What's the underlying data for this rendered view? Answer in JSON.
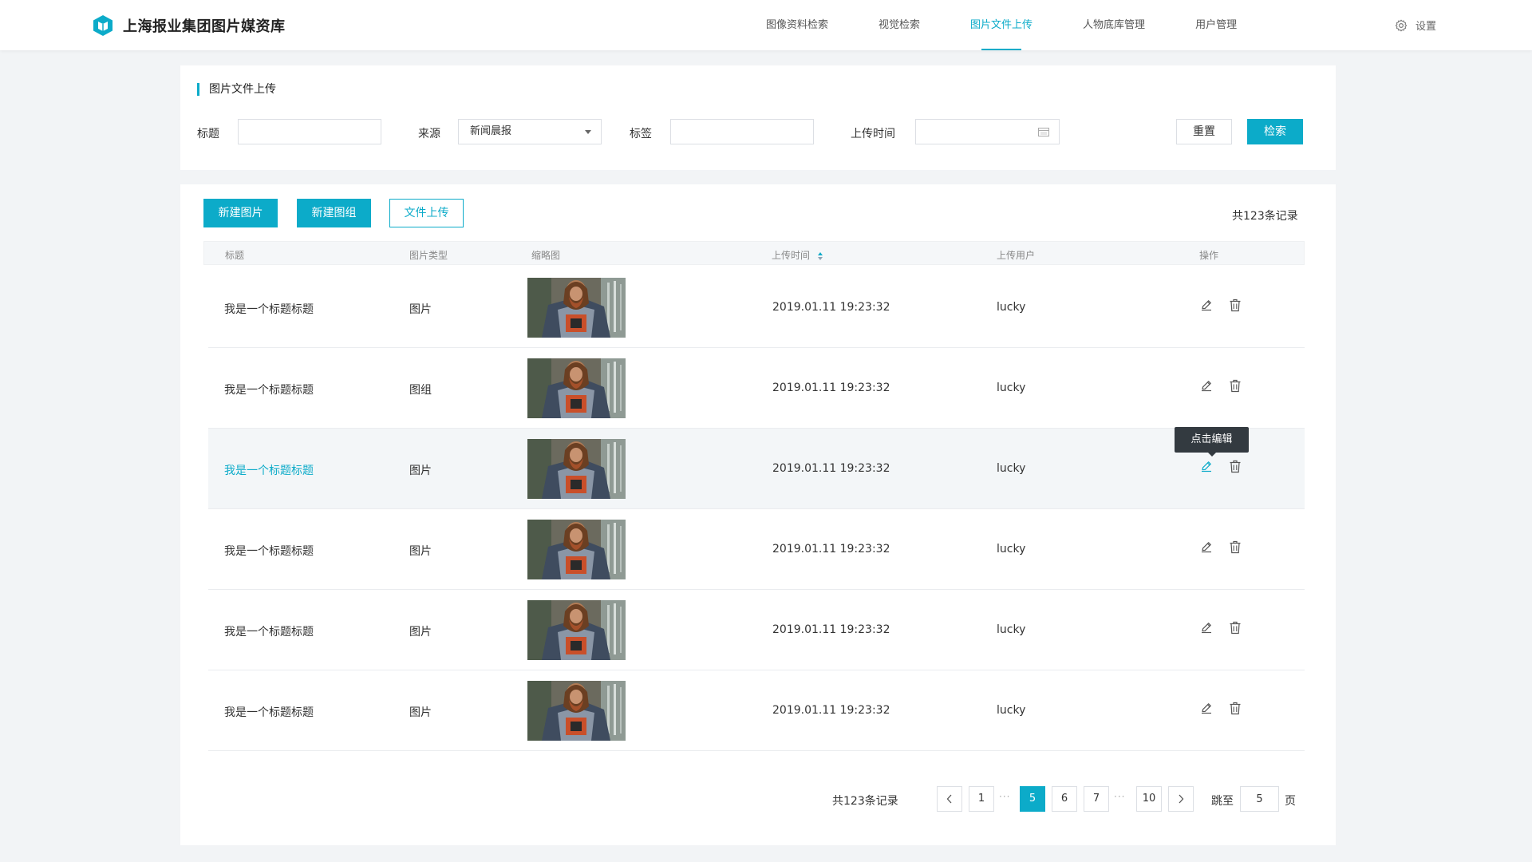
{
  "app": {
    "title": "上海报业集团图片媒资库",
    "accent_color": "#0cabc9"
  },
  "nav": {
    "items": [
      {
        "label": "图像资料检索",
        "active": false
      },
      {
        "label": "视觉检索",
        "active": false
      },
      {
        "label": "图片文件上传",
        "active": true
      },
      {
        "label": "人物底库管理",
        "active": false
      },
      {
        "label": "用户管理",
        "active": false
      }
    ],
    "settings_label": "设置",
    "settings_icon": "gear-icon"
  },
  "filter": {
    "section_title": "图片文件上传",
    "title_label": "标题",
    "title_value": "",
    "source_label": "来源",
    "source_value": "新闻晨报",
    "tag_label": "标签",
    "tag_value": "",
    "upload_time_label": "上传时间",
    "upload_time_value": "",
    "reset_button": "重置",
    "search_button": "检索"
  },
  "toolbar": {
    "new_image": "新建图片",
    "new_group": "新建图组",
    "file_upload": "文件上传",
    "total": "共123条记录"
  },
  "table": {
    "columns": [
      "标题",
      "图片类型",
      "缩略图",
      "上传时间",
      "上传用户",
      "操作"
    ],
    "sorted_column": "上传时间",
    "rows": [
      {
        "title": "我是一个标题标题",
        "type": "图片",
        "time": "2019.01.11 19:23:32",
        "user": "lucky"
      },
      {
        "title": "我是一个标题标题",
        "type": "图组",
        "time": "2019.01.11 19:23:32",
        "user": "lucky"
      },
      {
        "title": "我是一个标题标题",
        "type": "图片",
        "time": "2019.01.11 19:23:32",
        "user": "lucky"
      },
      {
        "title": "我是一个标题标题",
        "type": "图片",
        "time": "2019.01.11 19:23:32",
        "user": "lucky"
      },
      {
        "title": "我是一个标题标题",
        "type": "图片",
        "time": "2019.01.11 19:23:32",
        "user": "lucky"
      },
      {
        "title": "我是一个标题标题",
        "type": "图片",
        "time": "2019.01.11 19:23:32",
        "user": "lucky"
      }
    ],
    "hovered_row": 3,
    "tooltip": "点击编辑"
  },
  "pagination": {
    "total": "共123条记录",
    "pages": [
      "1",
      "5",
      "6",
      "7",
      "10"
    ],
    "current": "5",
    "ellipsis": "···",
    "jump_label": "跳至",
    "jump_value": "5",
    "page_suffix": "页"
  }
}
